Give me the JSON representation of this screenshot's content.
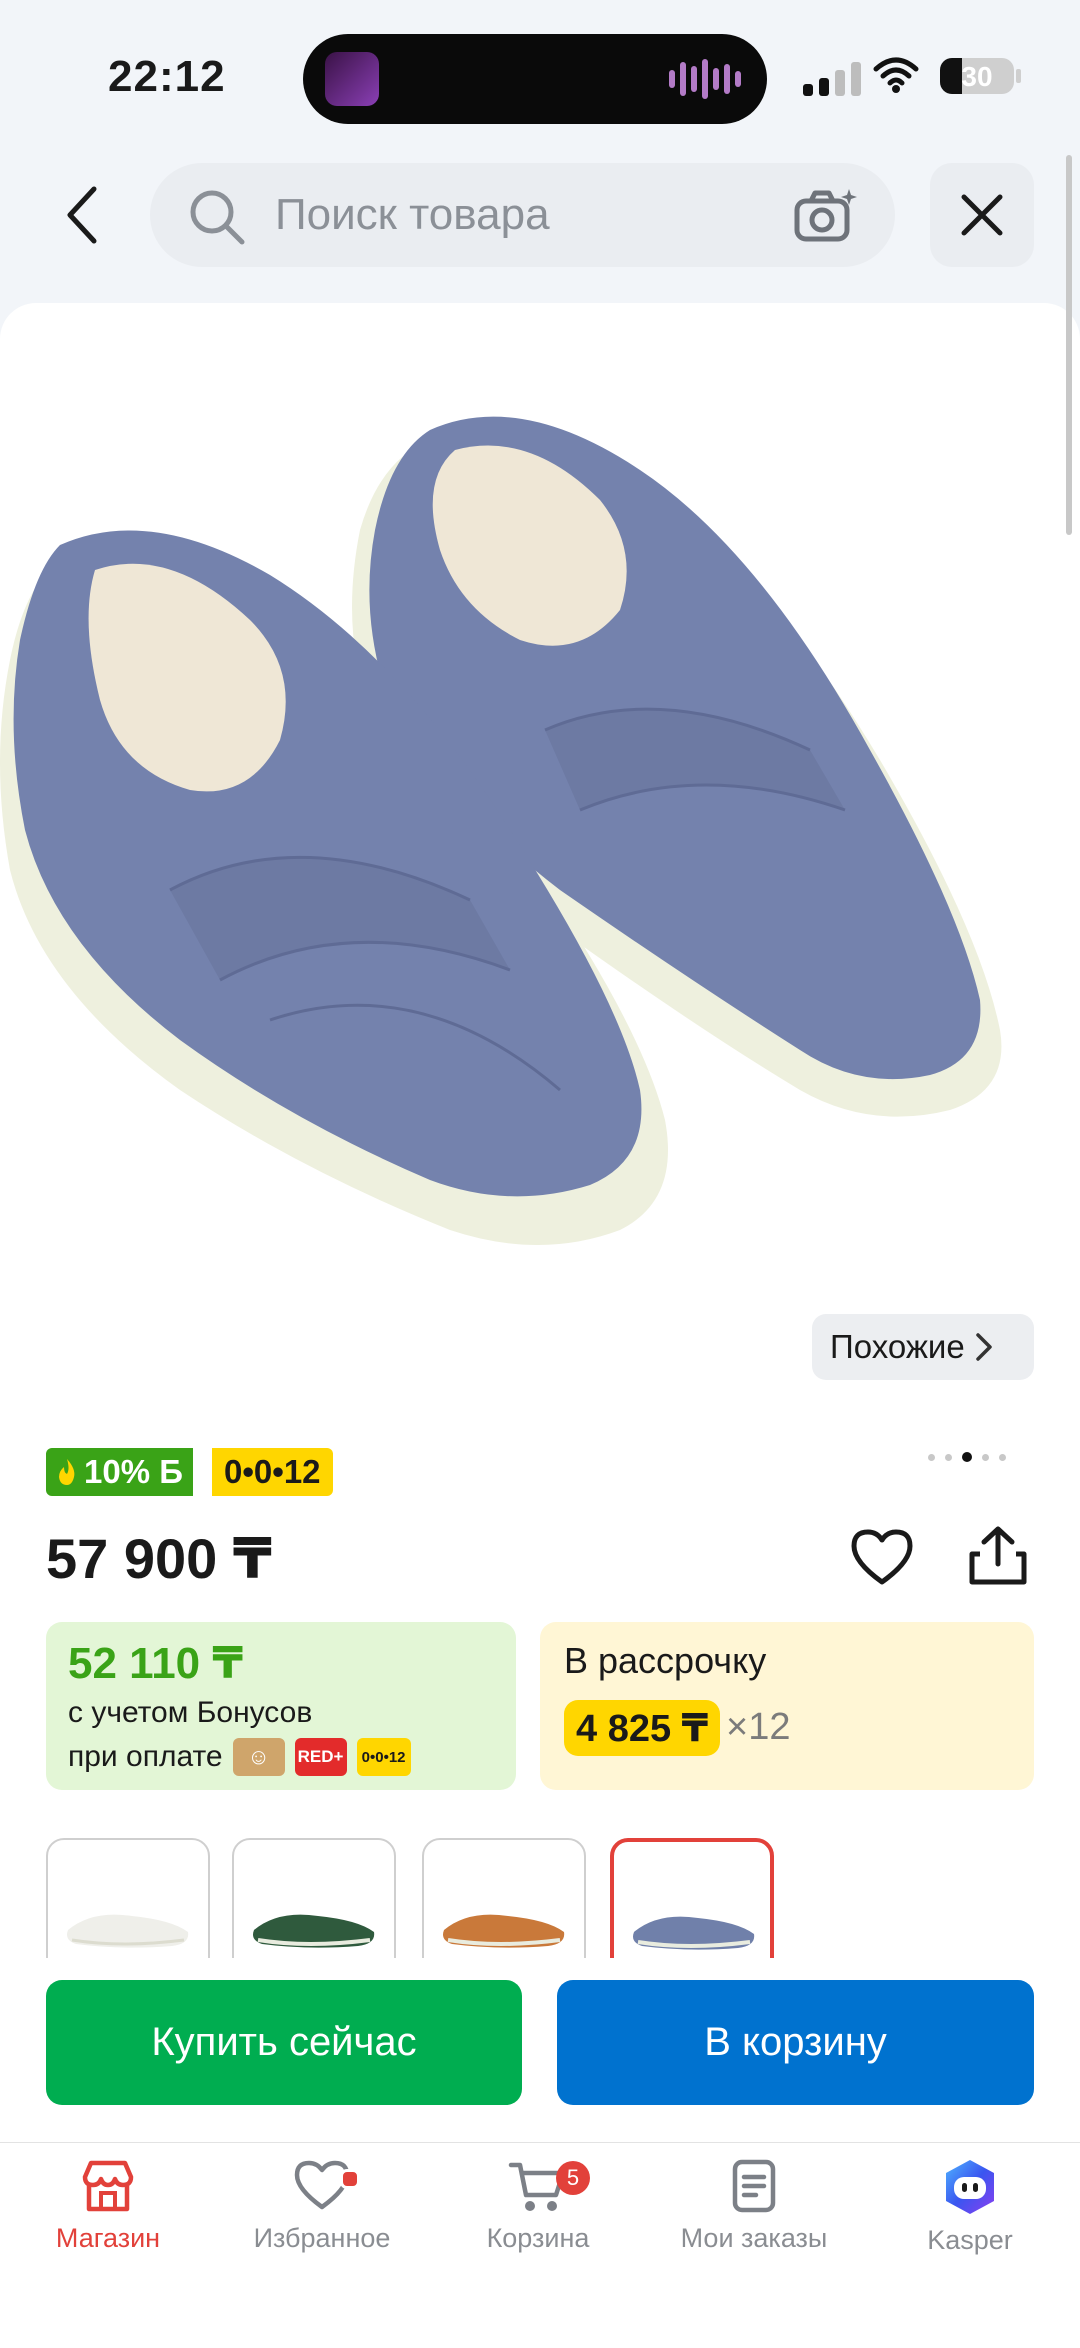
{
  "status_bar": {
    "time": "22:12",
    "battery": "30",
    "icons": [
      "signal-icon",
      "wifi-icon",
      "battery-icon"
    ]
  },
  "header": {
    "search_placeholder": "Поиск товара",
    "icons": [
      "back-icon",
      "search-icon",
      "camera-icon",
      "close-icon"
    ]
  },
  "product": {
    "similar_label": "Похожие",
    "bonus_badge": "10% Б",
    "installment_badge": "0•0•12",
    "price": "57 900 ₸",
    "gallery_total_images": 5,
    "gallery_active_index": 2,
    "bonus_box": {
      "price": "52 110 ₸",
      "line1": "с учетом Бонусов",
      "line2": "при оплате",
      "badges": [
        "RED+",
        "0•0•12"
      ]
    },
    "installment_box": {
      "title": "В рассрочку",
      "amount": "4 825 ₸",
      "multiplier": "×12"
    },
    "variants": [
      {
        "name": "white",
        "color": "#efefea"
      },
      {
        "name": "green",
        "color": "#2f5a3d"
      },
      {
        "name": "orange",
        "color": "#c9793a"
      },
      {
        "name": "blue",
        "color": "#7080aa",
        "selected": true
      }
    ],
    "colors": {
      "suede": "#7482ad",
      "sole": "#ecefdc",
      "accent_red": "#e2413a",
      "buy_green": "#00ad50",
      "cart_blue": "#0072cf",
      "bonus_green": "#3aa317",
      "plan_yellow": "#ffd600"
    }
  },
  "actions": {
    "buy_now": "Купить сейчас",
    "add_to_cart": "В корзину"
  },
  "tabbar": {
    "items": [
      {
        "label": "Магазин",
        "icon": "store-icon",
        "active": true
      },
      {
        "label": "Избранное",
        "icon": "heart-icon"
      },
      {
        "label": "Корзина",
        "icon": "cart-icon",
        "badge": "5"
      },
      {
        "label": "Мои заказы",
        "icon": "orders-icon"
      },
      {
        "label": "Kasper",
        "icon": "kasper-icon"
      }
    ]
  }
}
